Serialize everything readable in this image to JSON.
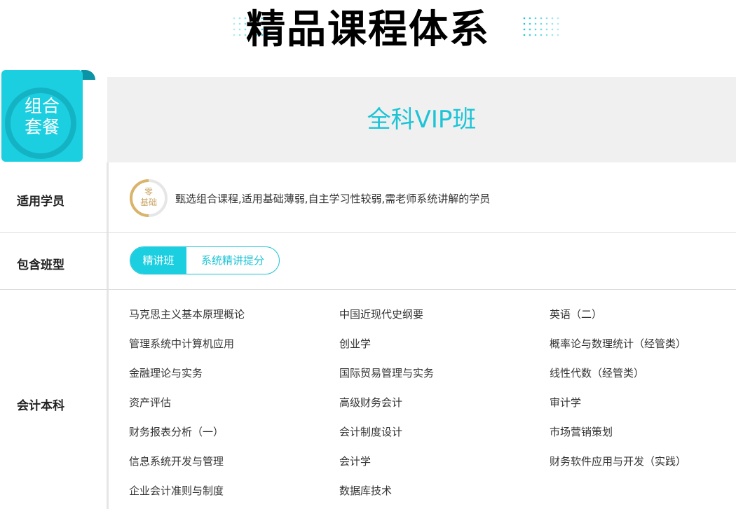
{
  "title": "精品课程体系",
  "badge": {
    "line1": "组合",
    "line2": "套餐"
  },
  "header": {
    "title": "全科VIP班"
  },
  "rows": {
    "audience": {
      "label": "适用学员",
      "icon_line1": "零",
      "icon_line2": "基础",
      "description": "甄选组合课程,适用基础薄弱,自主学习性较弱,需老师系统讲解的学员"
    },
    "classes": {
      "label": "包含班型",
      "tabs": [
        {
          "label": "精讲班",
          "active": true
        },
        {
          "label": "系统精讲提分",
          "active": false
        }
      ]
    },
    "courses": {
      "label": "会计本科",
      "items": [
        "马克思主义基本原理概论",
        "中国近现代史纲要",
        "英语（二）",
        "管理系统中计算机应用",
        "创业学",
        "概率论与数理统计（经管类）",
        "金融理论与实务",
        "国际贸易管理与实务",
        "线性代数（经管类）",
        "资产评估",
        "高级财务会计",
        "审计学",
        "财务报表分析（一）",
        "会计制度设计",
        "市场营销策划",
        "信息系统开发与管理",
        "会计学",
        "财务软件应用与开发（实践）",
        "企业会计准则与制度",
        "数据库技术"
      ]
    }
  },
  "colors": {
    "accent": "#1ccfe0",
    "accent_dark": "#13b3c4",
    "gold": "#c8a464"
  }
}
